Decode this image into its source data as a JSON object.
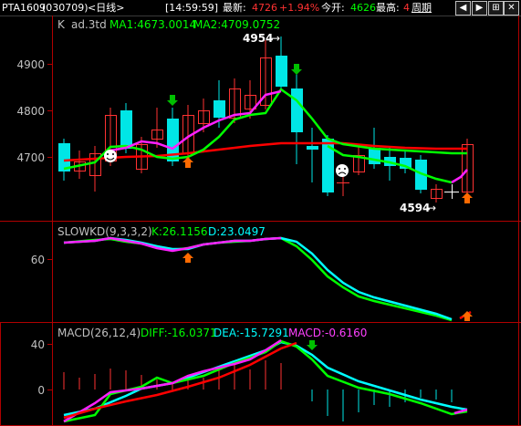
{
  "header": {
    "symbol": "PTA1609",
    "code": "(030709)",
    "period": "<日线>",
    "time": "[14:59:59]",
    "latest_label": "最新:",
    "latest_value": "4726",
    "change_pct": "+1.94%",
    "open_label": "今开:",
    "open_value": "4626",
    "high_label": "最高:",
    "high_value": "4",
    "cycle_label": "周期"
  },
  "main_panel": {
    "title": "K",
    "code": "ad.3td",
    "ma1": "MA1:4673.0014",
    "ma2": "MA2:4709.0752",
    "y_ticks": [
      "4900",
      "4800",
      "4700"
    ],
    "high_mark": "4954",
    "low_mark": "4594"
  },
  "kd_panel": {
    "title": "SLOWKD(9,3,3,2)",
    "k": "K:26.1156",
    "d": "D:23.0497",
    "y_ticks": [
      "60"
    ]
  },
  "macd_panel": {
    "title": "MACD(26,12,4)",
    "diff": "DIFF:-16.0371",
    "dea": "DEA:-15.7291",
    "macd": "MACD:-0.6160",
    "y_ticks": [
      "40",
      "0"
    ]
  },
  "colors": {
    "up": "#ff3232",
    "down": "#00e6e6",
    "ma1": "#ff20ff",
    "ma2": "#00ff00",
    "ma3": "#ff0000",
    "kline": "#00ffff",
    "label_green": "#00ff00",
    "label_cyan": "#00ffff",
    "label_magenta": "#ff40ff"
  },
  "icons": [
    "smile-face-icon",
    "frown-face-icon",
    "down-arrow-signal-icon",
    "up-arrow-signal-icon",
    "crosshair-icon",
    "prev-button",
    "next-button",
    "maximize-button"
  ]
}
